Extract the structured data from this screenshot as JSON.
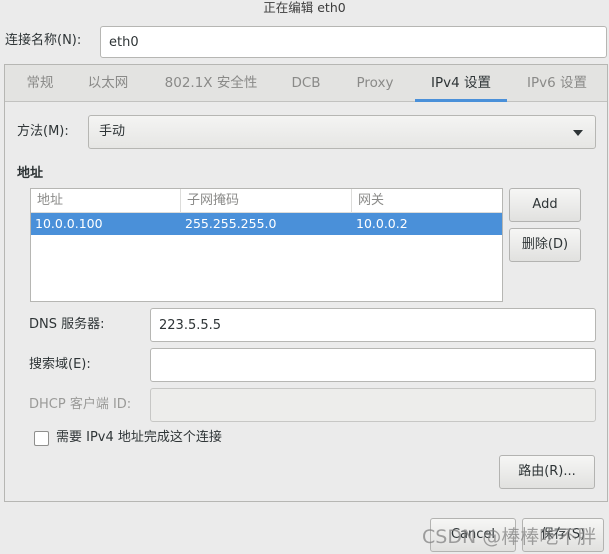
{
  "window": {
    "title": "正在编辑 eth0"
  },
  "connection": {
    "name_label": "连接名称(N):",
    "name_value": "eth0"
  },
  "tabs": [
    {
      "label": "常规"
    },
    {
      "label": "以太网"
    },
    {
      "label": "802.1X 安全性"
    },
    {
      "label": "DCB"
    },
    {
      "label": "Proxy"
    },
    {
      "label": "IPv4 设置"
    },
    {
      "label": "IPv6 设置"
    }
  ],
  "ipv4": {
    "method_label": "方法(M):",
    "method_value": "手动",
    "address_section": "地址",
    "columns": [
      "地址",
      "子网掩码",
      "网关"
    ],
    "rows": [
      [
        "10.0.0.100",
        "255.255.255.0",
        "10.0.0.2"
      ]
    ],
    "add_button": "Add",
    "delete_button": "删除(D)",
    "dns_label": "DNS 服务器:",
    "dns_value": "223.5.5.5",
    "search_label": "搜索域(E):",
    "search_value": "",
    "dhcp_label": "DHCP 客户端 ID:",
    "dhcp_value": "",
    "require_label": "需要 IPv4 地址完成这个连接",
    "routes_button": "路由(R)..."
  },
  "footer": {
    "cancel_button": "Cancel",
    "save_button": "保存(S)"
  },
  "watermark": "CSDN @棒棒吃不胖"
}
